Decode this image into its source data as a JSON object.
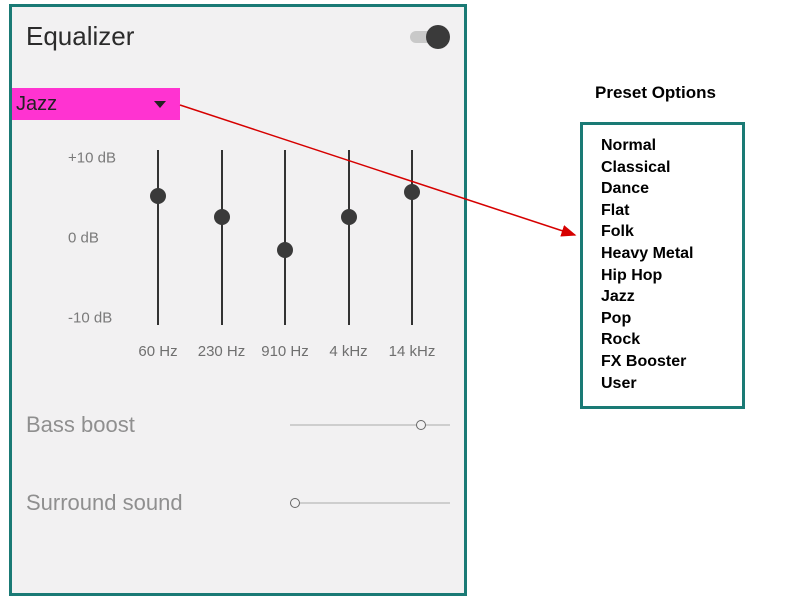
{
  "header": {
    "title": "Equalizer",
    "toggle_on": true
  },
  "preset": {
    "selected": "Jazz"
  },
  "axis": {
    "top": "+10 dB",
    "mid": "0 dB",
    "bottom": "-10 dB"
  },
  "bands": [
    {
      "freq": "60 Hz",
      "position_pct": 26
    },
    {
      "freq": "230 Hz",
      "position_pct": 38
    },
    {
      "freq": "910 Hz",
      "position_pct": 57
    },
    {
      "freq": "4 kHz",
      "position_pct": 38
    },
    {
      "freq": "14 kHz",
      "position_pct": 24
    }
  ],
  "bass": {
    "label": "Bass boost",
    "value_pct": 82
  },
  "surround": {
    "label": "Surround sound",
    "value_pct": 3
  },
  "presets_panel": {
    "heading": "Preset Options",
    "options": [
      "Normal",
      "Classical",
      "Dance",
      "Flat",
      "Folk",
      "Heavy Metal",
      "Hip Hop",
      "Jazz",
      "Pop",
      "Rock",
      "FX Booster",
      "User"
    ]
  }
}
